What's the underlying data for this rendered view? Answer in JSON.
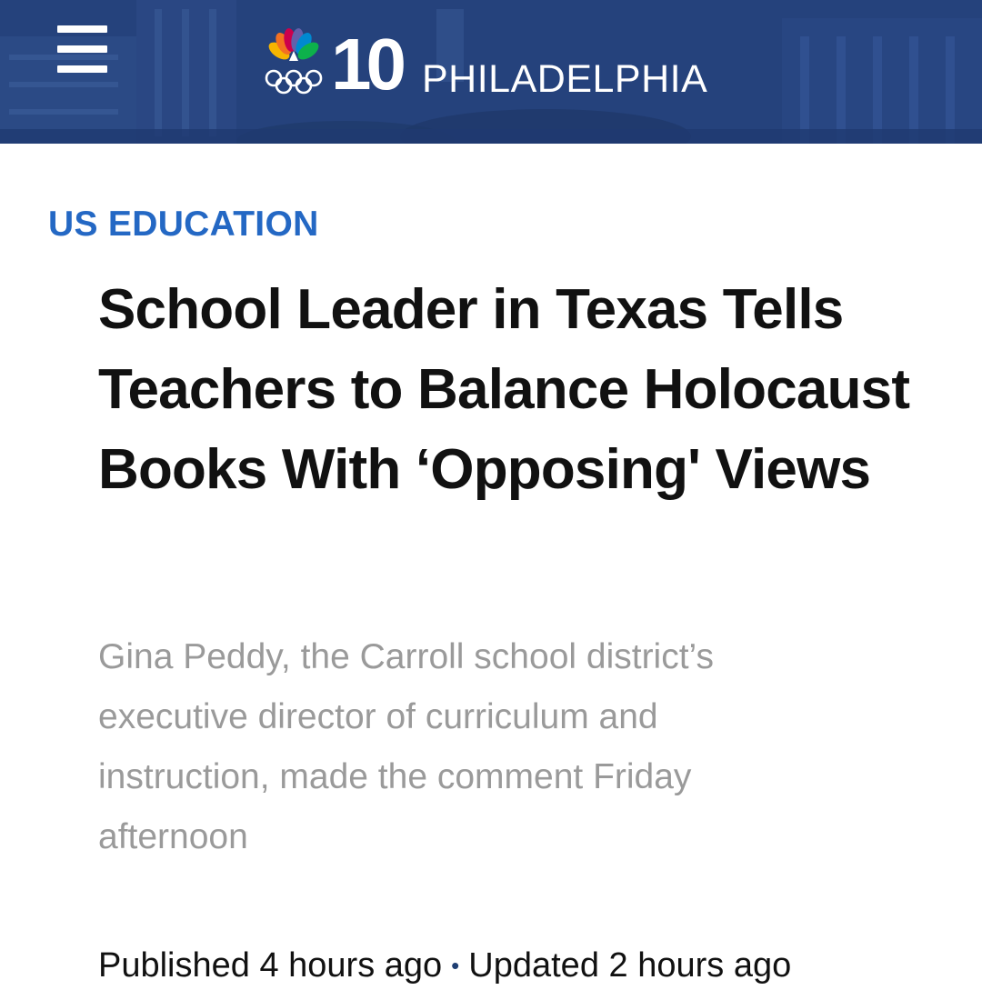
{
  "header": {
    "menu_icon": "hamburger-menu-icon",
    "logo_icon": "nbc-peacock-olympic-rings-icon",
    "channel_number": "10",
    "station_name": "PHILADELPHIA"
  },
  "article": {
    "category": "US EDUCATION",
    "headline": "School Leader in Texas Tells Teachers to Balance Holocaust Books With ‘Opposing' Views",
    "dek": "Gina Peddy, the Carroll school district’s executive director of curriculum and instruction, made the comment Friday afternoon",
    "published": "Published 4 hours ago",
    "separator": "•",
    "updated": "Updated 2 hours ago"
  },
  "colors": {
    "header_background": "#23407a",
    "category": "#2468c4",
    "headline": "#111111",
    "dek": "#9a9a9a"
  }
}
